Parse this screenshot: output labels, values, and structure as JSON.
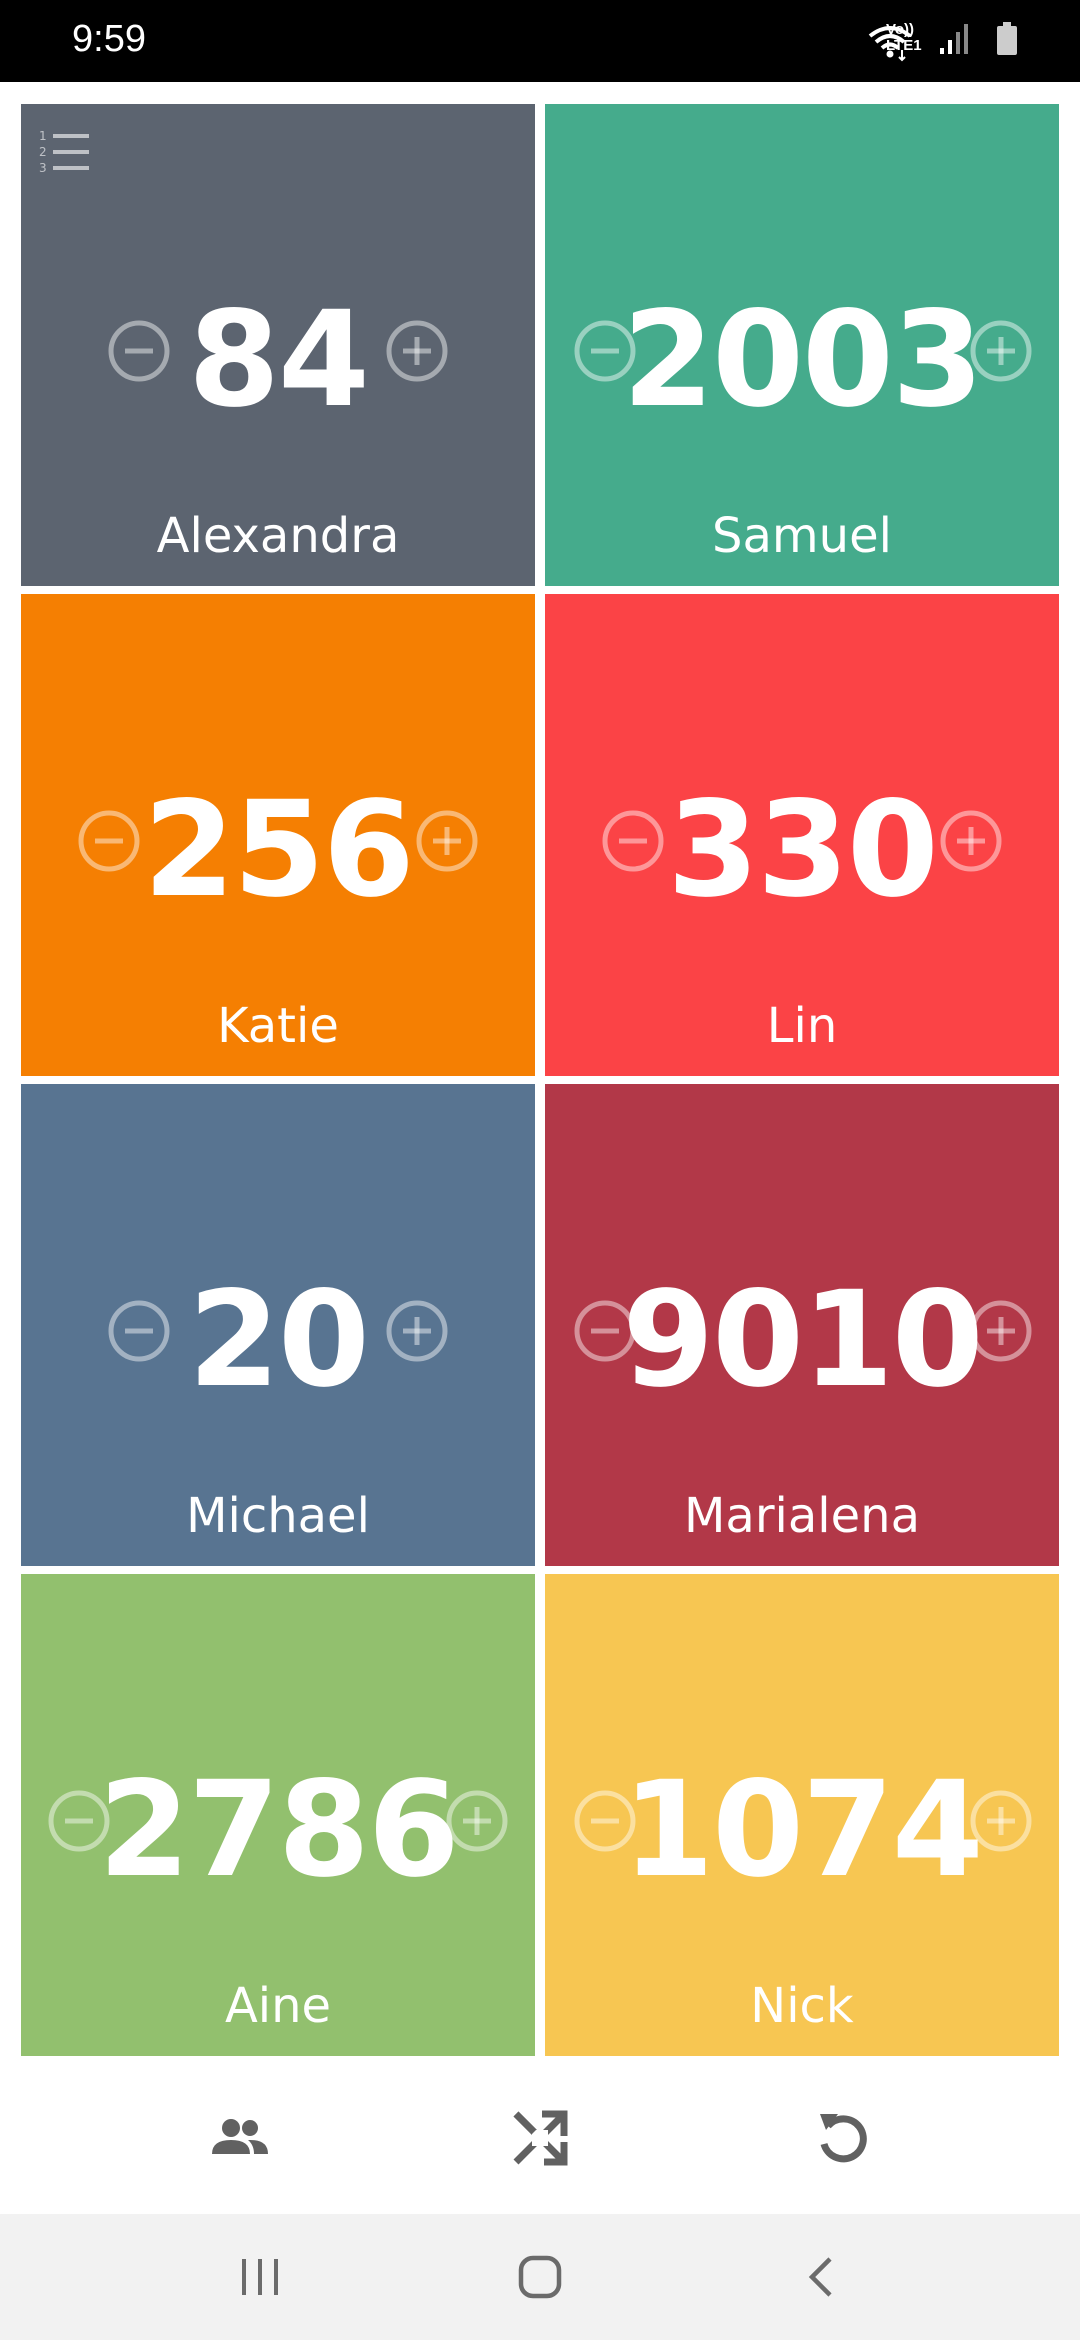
{
  "status_bar": {
    "time": "9:59",
    "network_label": "Vo)) LTE1",
    "icons": [
      "wifi-icon",
      "lte-icon",
      "signal-icon",
      "battery-icon"
    ]
  },
  "players": [
    {
      "name": "Alexandra",
      "score": "84",
      "color": "#5c6470"
    },
    {
      "name": "Samuel",
      "score": "2003",
      "color": "#45ab8c"
    },
    {
      "name": "Katie",
      "score": "256",
      "color": "#f57f02"
    },
    {
      "name": "Lin",
      "score": "330",
      "color": "#fb4346"
    },
    {
      "name": "Michael",
      "score": "20",
      "color": "#587491"
    },
    {
      "name": "Marialena",
      "score": "9010",
      "color": "#b23848"
    },
    {
      "name": "Aine",
      "score": "2786",
      "color": "#92c06e"
    },
    {
      "name": "Nick",
      "score": "1074",
      "color": "#f7c652"
    }
  ],
  "icons": {
    "rank": "numbered-list-icon",
    "decrement": "minus-circle-icon",
    "increment": "plus-circle-icon",
    "toolbar": [
      "people-icon",
      "shuffle-icon",
      "reset-icon"
    ],
    "nav": [
      "recent-apps-icon",
      "home-icon",
      "back-icon"
    ]
  },
  "colors": {
    "toolbar_icon": "#616161",
    "nav_icon": "#6b6b6b",
    "control_overlay": "rgba(255,255,255,0.45)"
  }
}
